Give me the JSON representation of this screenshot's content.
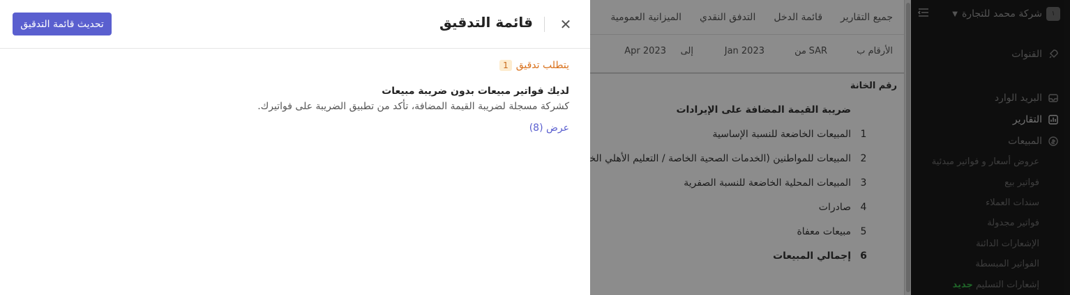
{
  "sidebar": {
    "company": "شركة محمد للتجارة",
    "logo_text": "١",
    "items": [
      {
        "label": "القنوات"
      },
      {
        "label": "البريد الوارد"
      },
      {
        "label": "التقارير"
      },
      {
        "label": "المبيعات"
      }
    ],
    "sub_items": [
      {
        "label": "عروض أسعار و فواتير مبدئية"
      },
      {
        "label": "فواتير بيع"
      },
      {
        "label": "سندات العملاء"
      },
      {
        "label": "فواتير مجدولة"
      },
      {
        "label": "الإشعارات الدائنة"
      },
      {
        "label": "الفواتير المبسطة"
      },
      {
        "label": "إشعارات التسليم",
        "badge": "جديد"
      }
    ]
  },
  "report": {
    "tabs": [
      "جميع التقارير",
      "قائمة الدخل",
      "التدفق النقدي",
      "الميزانية العمومية"
    ],
    "filters": {
      "numbers_in": "الأرقام ب",
      "currency": "SAR",
      "from_label": "من",
      "from_value": "Jan 2023",
      "to_label": "إلى",
      "to_value": "Apr 2023"
    },
    "column_header": "رقم الخانة",
    "section_title": "ضريبة القيمة المضافة على الإيرادات",
    "rows": [
      {
        "num": "1",
        "label": "المبيعات الخاضعة للنسبة الإساسية"
      },
      {
        "num": "2",
        "label": "المبيعات للمواطنين (الخدمات الصحية الخاصة / التعليم الأهلي الخاص)"
      },
      {
        "num": "3",
        "label": "المبيعات المحلية الخاضعة للنسبة الصفرية"
      },
      {
        "num": "4",
        "label": "صادرات"
      },
      {
        "num": "5",
        "label": "مبيعات معفاة"
      },
      {
        "num": "6",
        "label": "إجمالي المبيعات"
      }
    ]
  },
  "panel": {
    "title": "قائمة التدقيق",
    "refresh_label": "تحديث قائمة التدقيق",
    "section_label": "يتطلب تدقيق",
    "section_count": "1",
    "item_title": "لديك فواتير مبيعات بدون ضريبة مبيعات",
    "item_desc": "كشركة مسجلة لضريبة القيمة المضافة، تأكد من تطبيق الضريبة على فواتيرك.",
    "item_link": "عرض (8)"
  },
  "colors": {
    "accent": "#5a5fcf",
    "warning": "#d9711c",
    "success": "#39b54a"
  }
}
